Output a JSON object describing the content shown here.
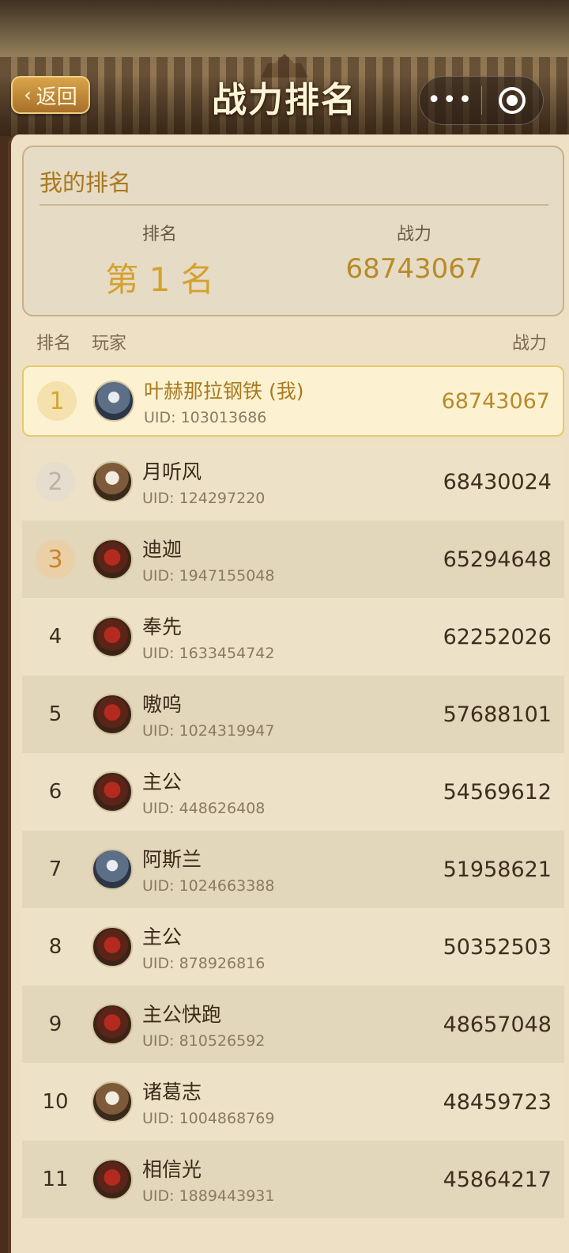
{
  "header": {
    "back_label": "返回",
    "title": "战力排名",
    "more_icon": "•••"
  },
  "my_rank": {
    "title": "我的排名",
    "rank_label": "排名",
    "rank_value": "第 1 名",
    "power_label": "战力",
    "power_value": "68743067"
  },
  "list_header": {
    "rank": "排名",
    "player": "玩家",
    "power": "战力"
  },
  "rows": [
    {
      "rank": "1",
      "name": "叶赫那拉钢铁 (我)",
      "uid": "UID: 103013686",
      "power": "68743067"
    },
    {
      "rank": "2",
      "name": "月听风",
      "uid": "UID: 124297220",
      "power": "68430024"
    },
    {
      "rank": "3",
      "name": "迪迦",
      "uid": "UID: 1947155048",
      "power": "65294648"
    },
    {
      "rank": "4",
      "name": "奉先",
      "uid": "UID: 1633454742",
      "power": "62252026"
    },
    {
      "rank": "5",
      "name": "嗷呜",
      "uid": "UID: 1024319947",
      "power": "57688101"
    },
    {
      "rank": "6",
      "name": "主公",
      "uid": "UID: 448626408",
      "power": "54569612"
    },
    {
      "rank": "7",
      "name": "阿斯兰",
      "uid": "UID: 1024663388",
      "power": "51958621"
    },
    {
      "rank": "8",
      "name": "主公",
      "uid": "UID: 878926816",
      "power": "50352503"
    },
    {
      "rank": "9",
      "name": "主公快跑",
      "uid": "UID: 810526592",
      "power": "48657048"
    },
    {
      "rank": "10",
      "name": "诸葛志",
      "uid": "UID: 1004868769",
      "power": "48459723"
    },
    {
      "rank": "11",
      "name": "相信光",
      "uid": "UID: 1889443931",
      "power": "45864217"
    }
  ],
  "colors": {
    "accent_gold": "#d4a132",
    "me_highlight": "#fcf2d2"
  }
}
